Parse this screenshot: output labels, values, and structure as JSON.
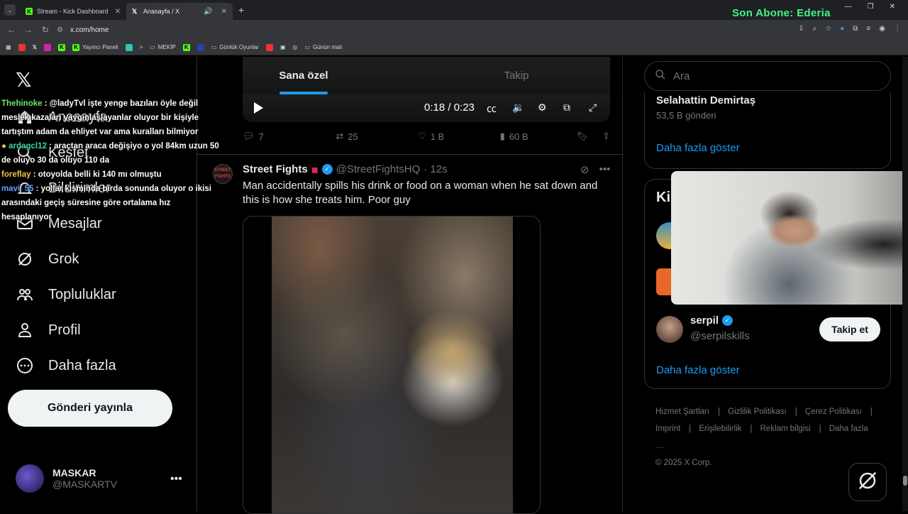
{
  "browser": {
    "tabs": [
      {
        "title": "Stream - Kick Dashboard",
        "active": false
      },
      {
        "title": "Anasayfa / X",
        "active": true
      }
    ],
    "url": "x.com/home",
    "overlay_text": "Son Abone: Ederia",
    "bookmarks": [
      "Yayıncı Paneli",
      "MEKİP",
      "Günlük Oyunlar",
      "Günün malı"
    ]
  },
  "nav": {
    "items": [
      {
        "label": "Anasayfa",
        "icon": "home-icon"
      },
      {
        "label": "Keşfet",
        "icon": "search-icon"
      },
      {
        "label": "Bildirimler",
        "icon": "bell-icon"
      },
      {
        "label": "Mesajlar",
        "icon": "mail-icon"
      },
      {
        "label": "Grok",
        "icon": "grok-icon"
      },
      {
        "label": "Topluluklar",
        "icon": "communities-icon"
      },
      {
        "label": "Profil",
        "icon": "profile-icon"
      },
      {
        "label": "Daha fazla",
        "icon": "more-circle-icon"
      }
    ],
    "post_button": "Gönderi yayınla",
    "account": {
      "name": "MASKAR",
      "handle": "@MASKARTV"
    }
  },
  "chat": [
    {
      "user": "Thehinoke",
      "text": ": @ladyTvl işte yenge bazıları öyle değil meslek kazaları yaygınlaşlayanlar oluyor bir kişiyle tartıştım adam da ehliyet var ama kuralları bilmiyor"
    },
    {
      "user": "ardagcl12",
      "text": ": araçtan araca değişiyo o yol 84km uzun 50 de oluyo 30 da oluyo 110 da"
    },
    {
      "user": "foreflay",
      "text": ": otoyolda belli ki 140 mı olmuştu"
    },
    {
      "user": "mavi_55",
      "text": ": yollar kısmında birda sonunda oluyor o ikisi arasındaki geçiş süresine göre ortalama hız hesaplanıyor"
    }
  ],
  "feed": {
    "tabs": [
      "Sana özel",
      "Takip"
    ],
    "video": {
      "time": "0:18 / 0:23"
    },
    "actions": {
      "replies": "7",
      "reposts": "25",
      "likes": "1 B",
      "views": "60 B"
    },
    "post": {
      "name": "Street Fights",
      "handle": "@StreetFightsHQ",
      "time": "· 12s",
      "avatar_text": "STREET FIGHTS",
      "text": "Man accidentally spills his drink or food on a woman when he sat down and this is how she treats him. Poor guy"
    }
  },
  "sidebar": {
    "search_placeholder": "Ara",
    "trend": {
      "name": "Selahattin Demirtaş",
      "count": "53,5 B gönderi"
    },
    "show_more": "Daha fazla göster",
    "who_to_follow_title": "Ki",
    "suggestion": {
      "name": "serpil",
      "handle": "@serpilskills",
      "button": "Takip et"
    },
    "footer": [
      "Hizmet Şartları",
      "Gizlilik Politikası",
      "Çerez Politikası",
      "Imprint",
      "Erişilebilirlik",
      "Reklam bilgisi",
      "Daha fazla …",
      "© 2025 X Corp."
    ]
  }
}
